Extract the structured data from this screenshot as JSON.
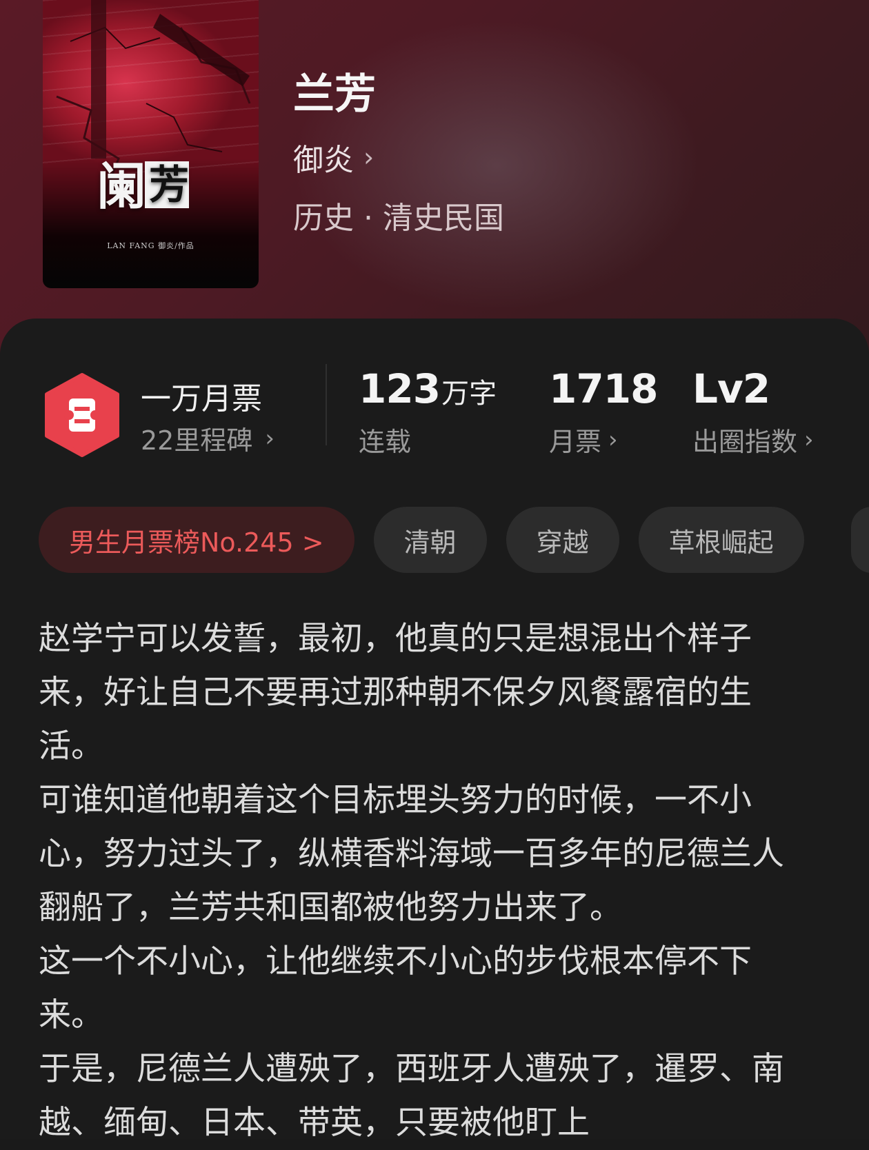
{
  "book": {
    "title": "兰芳",
    "author": "御炎",
    "genre": "历史 · 清史民国",
    "cover": {
      "title_art_a": "阑",
      "title_art_b": "芳",
      "credit": "LAN FANG 御炎/作品"
    }
  },
  "milestone": {
    "title": "一万月票",
    "subtitle": "22里程碑",
    "icon": "ticket-hexagon-icon",
    "color": "#e8414c"
  },
  "stats": {
    "words": {
      "value": "123",
      "unit": "万字",
      "label": "连载"
    },
    "monthly_tickets": {
      "value": "1718",
      "label": "月票"
    },
    "popularity": {
      "value": "Lv2",
      "label": "出圈指数"
    }
  },
  "tags": {
    "rank": "男生月票榜No.245 >",
    "items": [
      "清朝",
      "穿越",
      "草根崛起"
    ]
  },
  "synopsis": [
    "赵学宁可以发誓，最初，他真的只是想混出个样子来，好让自己不要再过那种朝不保夕风餐露宿的生活。",
    "可谁知道他朝着这个目标埋头努力的时候，一不小心，努力过头了，纵横香料海域一百多年的尼德兰人翻船了，兰芳共和国都被他努力出来了。",
    "这一个不小心，让他继续不小心的步伐根本停不下来。",
    "于是，尼德兰人遭殃了，西班牙人遭殃了，暹罗、南越、缅甸、日本、带英，只要被他盯上"
  ],
  "colors": {
    "accent_red": "#ec5a5a",
    "hero_bg": "#4d1a24",
    "panel_bg": "#1b1b1b"
  }
}
